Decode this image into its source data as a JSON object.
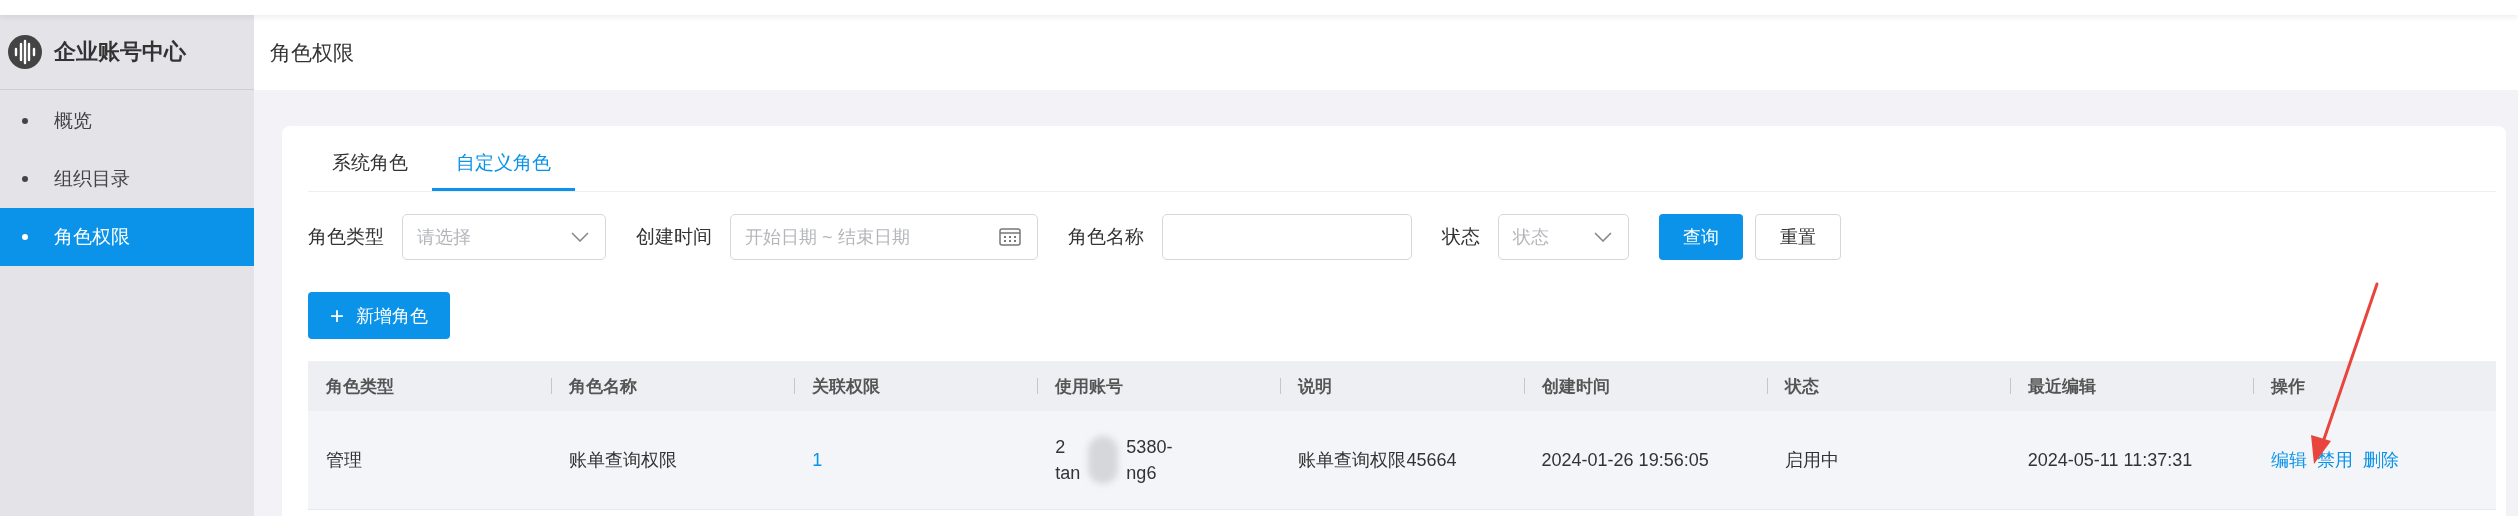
{
  "sidebar": {
    "title": "企业账号中心",
    "items": [
      {
        "label": "概览",
        "selected": false
      },
      {
        "label": "组织目录",
        "selected": false
      },
      {
        "label": "角色权限",
        "selected": true
      }
    ]
  },
  "header": {
    "title": "角色权限"
  },
  "tabs": [
    {
      "label": "系统角色",
      "selected": false
    },
    {
      "label": "自定义角色",
      "selected": true
    }
  ],
  "filters": [
    {
      "kind": "select",
      "label": "角色类型",
      "placeholder": "请选择"
    },
    {
      "kind": "daterange",
      "label": "创建时间",
      "placeholder_start": "开始日期",
      "separator": "~",
      "placeholder_end": "结束日期"
    },
    {
      "kind": "input",
      "label": "角色名称"
    },
    {
      "kind": "select",
      "label": "状态",
      "placeholder": "状态"
    }
  ],
  "buttons": [
    {
      "label": "查询",
      "kind": "primary"
    },
    {
      "label": "重置",
      "kind": "default"
    }
  ],
  "add_button": {
    "icon": "+",
    "label": "新增角色"
  },
  "table": {
    "columns": [
      "角色类型",
      "角色名称",
      "关联权限",
      "使用账号",
      "说明",
      "创建时间",
      "状态",
      "最近编辑",
      "操作"
    ],
    "rows": [
      {
        "cells": [
          {
            "kind": "text",
            "text": "管理"
          },
          {
            "kind": "text",
            "text": "账单查询权限"
          },
          {
            "kind": "link",
            "text": "1"
          },
          {
            "kind": "redacted",
            "lines": [
              [
                "2",
                "5380-"
              ],
              [
                "tan",
                "ng6"
              ]
            ]
          },
          {
            "kind": "text",
            "text": "账单查询权限45664"
          },
          {
            "kind": "text",
            "text": "2024-01-26 19:56:05"
          },
          {
            "kind": "text",
            "text": "启用中"
          },
          {
            "kind": "text",
            "text": "2024-05-11 11:37:31"
          },
          {
            "kind": "actions",
            "links": [
              "编辑",
              "禁用",
              "删除"
            ]
          }
        ]
      }
    ]
  }
}
